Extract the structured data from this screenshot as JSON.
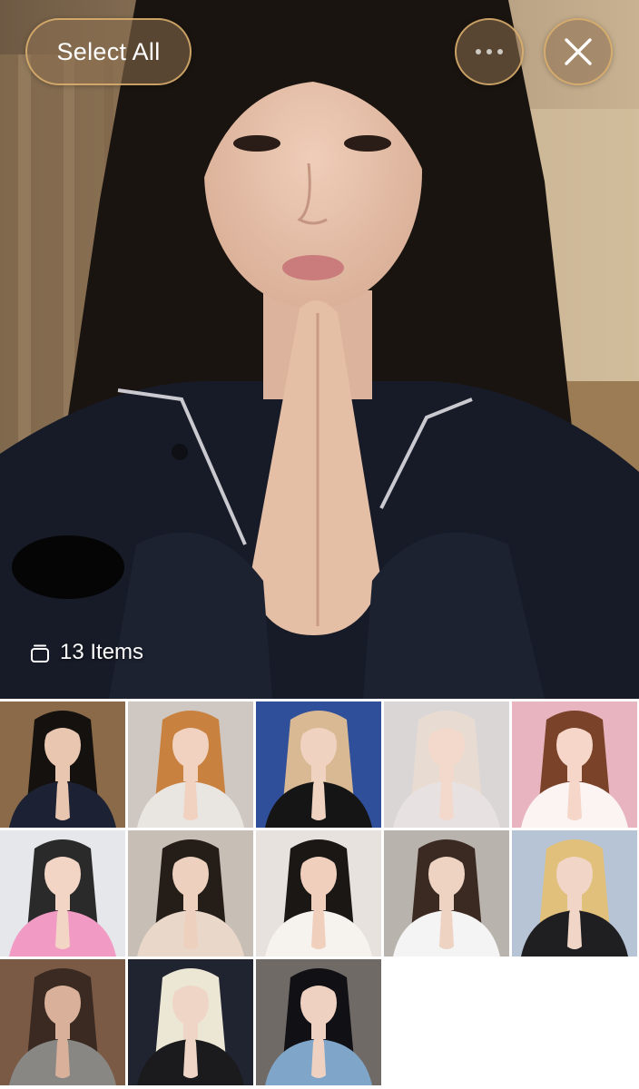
{
  "viewer": {
    "select_all_label": "Select All",
    "more_icon": "ellipsis-icon",
    "close_icon": "close-icon",
    "item_count_label": "13 Items",
    "stack_icon": "stack-icon"
  },
  "colors": {
    "button_border": "#deb26e",
    "button_fill": "#8c7050",
    "background": "#ffffff"
  },
  "thumbnails": [
    {
      "name": "thumb-1",
      "bg": "#8a6a48",
      "hair": "#15110e",
      "skin": "#e9c6b0",
      "outfit": "#1c2233"
    },
    {
      "name": "thumb-2",
      "bg": "#cfc8c2",
      "hair": "#c9813f",
      "skin": "#f1d2c0",
      "outfit": "#e9e6e2"
    },
    {
      "name": "thumb-3",
      "bg": "#2f4f9a",
      "hair": "#d9b993",
      "skin": "#f0d2c0",
      "outfit": "#151515"
    },
    {
      "name": "thumb-4",
      "bg": "#dad6d6",
      "hair": "#e8dcd2",
      "skin": "#f3d9cc",
      "outfit": "#e7e1e1"
    },
    {
      "name": "thumb-5",
      "bg": "#e8b4c0",
      "hair": "#7a4229",
      "skin": "#f5d6c8",
      "outfit": "#fbf4f2"
    },
    {
      "name": "thumb-6",
      "bg": "#e6e7ea",
      "hair": "#2a2a2a",
      "skin": "#f3d5c6",
      "outfit": "#f19ac4"
    },
    {
      "name": "thumb-7",
      "bg": "#c7bfb5",
      "hair": "#241d18",
      "skin": "#edd0bd",
      "outfit": "#e9d7c9"
    },
    {
      "name": "thumb-8",
      "bg": "#e8e2de",
      "hair": "#1b1715",
      "skin": "#f0d0bd",
      "outfit": "#f6f3ef"
    },
    {
      "name": "thumb-9",
      "bg": "#b8b3ac",
      "hair": "#3b2a22",
      "skin": "#efd3c2",
      "outfit": "#f4f4f4"
    },
    {
      "name": "thumb-10",
      "bg": "#b7c4d6",
      "hair": "#e0c07a",
      "skin": "#f1d6c7",
      "outfit": "#1f1f22"
    },
    {
      "name": "thumb-11",
      "bg": "#7b5a45",
      "hair": "#3a2a22",
      "skin": "#d9b09a",
      "outfit": "#888784"
    },
    {
      "name": "thumb-12",
      "bg": "#1f2430",
      "hair": "#ece6d4",
      "skin": "#efd5c6",
      "outfit": "#1b1b1d"
    },
    {
      "name": "thumb-13",
      "bg": "#6f6a66",
      "hair": "#111014",
      "skin": "#eed1c1",
      "outfit": "#7fa6c9"
    }
  ]
}
